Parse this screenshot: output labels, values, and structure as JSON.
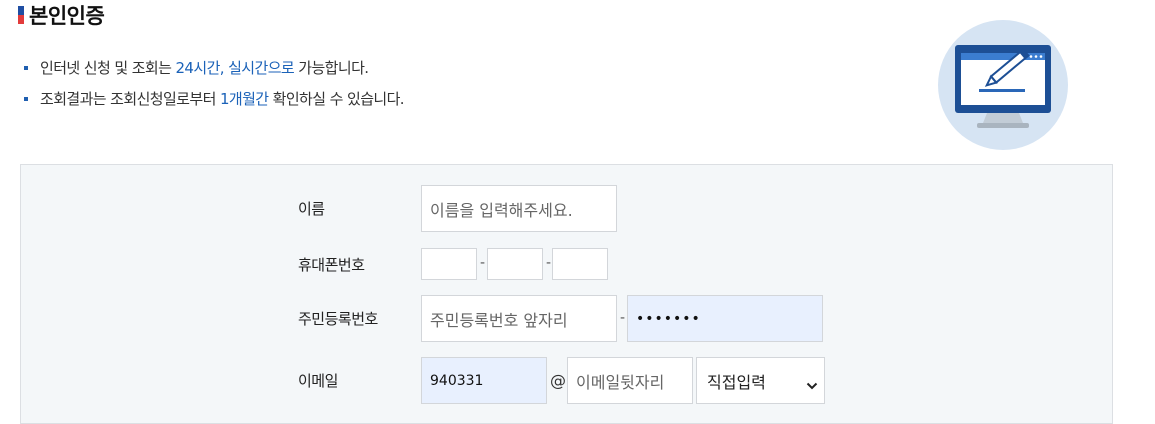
{
  "header": {
    "title": "본인인증"
  },
  "notices": [
    {
      "before": "인터넷 신청 및 조회는 ",
      "highlight": "24시간, 실시간으로",
      "after": " 가능합니다."
    },
    {
      "before": "조회결과는 조회신청일로부터 ",
      "highlight": "1개월간",
      "after": " 확인하실 수 있습니다."
    }
  ],
  "form": {
    "name": {
      "label": "이름",
      "placeholder": "이름을 입력해주세요."
    },
    "phone": {
      "label": "휴대폰번호",
      "separator": "-"
    },
    "rrn": {
      "label": "주민등록번호",
      "front_placeholder": "주민등록번호 앞자리",
      "separator": "-",
      "back_value": "•••••••"
    },
    "email": {
      "label": "이메일",
      "id_value": "940331",
      "at": "@",
      "domain_placeholder": "이메일뒷자리",
      "select_value": "직접입력"
    }
  },
  "colors": {
    "accent": "#1b62b8",
    "form_bg": "#f4f7f9",
    "autofill_bg": "#e8f0fe"
  }
}
